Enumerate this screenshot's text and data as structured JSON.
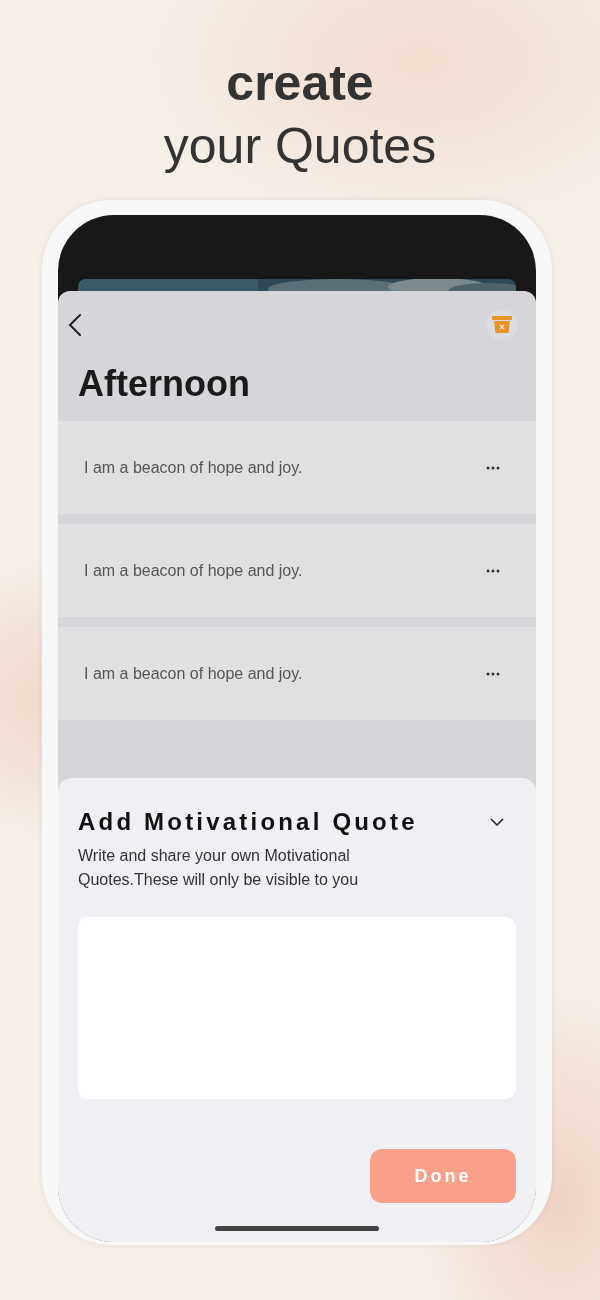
{
  "headline": {
    "line_1": "create",
    "line_2": "your Quotes"
  },
  "screen": {
    "title": "Afternoon",
    "quotes": [
      {
        "text": "I am a beacon of hope and joy."
      },
      {
        "text": "I am a beacon of hope and joy."
      },
      {
        "text": "I am a beacon of hope and joy."
      }
    ],
    "add_panel": {
      "title": "Add Motivational Quote",
      "description": "Write and share your own Motivational Quotes.These will only be visible to you",
      "done_button": "Done"
    }
  }
}
